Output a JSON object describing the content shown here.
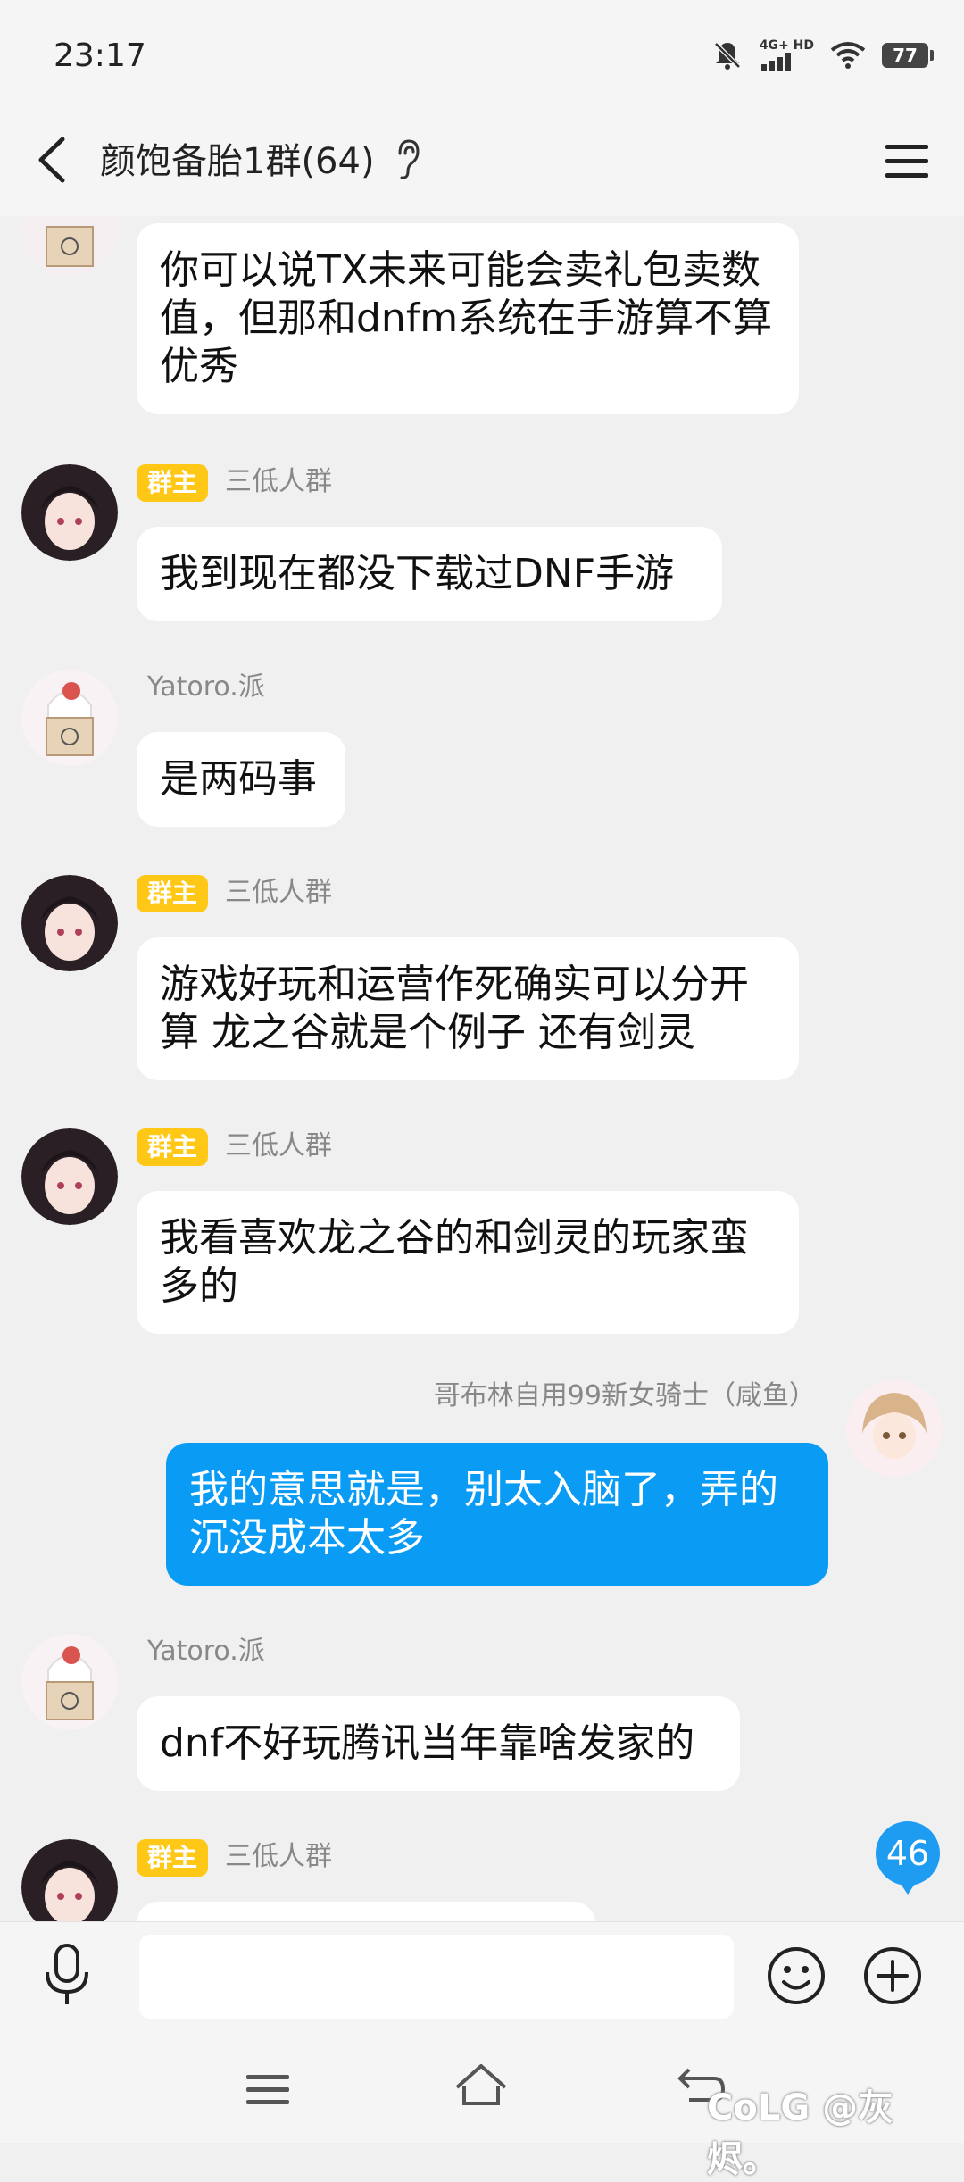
{
  "status_bar": {
    "time": "23:17",
    "network": "4G+ HD",
    "battery": "77"
  },
  "header": {
    "title": "颜饱备胎1群(64)"
  },
  "messages": [
    {
      "sender": "",
      "badge": "",
      "text": "你可以说TX未来可能会卖礼包卖数值，但那和dnfm系统在手游算不算优秀",
      "self": false
    },
    {
      "sender": "三低人群",
      "badge": "群主",
      "text": "我到现在都没下载过DNF手游",
      "self": false
    },
    {
      "sender": "Yatoro.派",
      "badge": "",
      "text": "是两码事",
      "self": false
    },
    {
      "sender": "三低人群",
      "badge": "群主",
      "text": "游戏好玩和运营作死确实可以分开算  龙之谷就是个例子 还有剑灵",
      "self": false
    },
    {
      "sender": "三低人群",
      "badge": "群主",
      "text": "我看喜欢龙之谷的和剑灵的玩家蛮多的",
      "self": false
    },
    {
      "sender": "哥布林自用99新女骑士（咸鱼）",
      "badge": "",
      "text": "我的意思就是，别太入脑了，弄的沉没成本太多",
      "self": true
    },
    {
      "sender": "Yatoro.派",
      "badge": "",
      "text": "dnf不好玩腾讯当年靠啥发家的",
      "self": false
    },
    {
      "sender": "三低人群",
      "badge": "群主",
      "text": "",
      "self": false
    }
  ],
  "unread_count": "46",
  "input": {
    "placeholder": ""
  },
  "watermark": "CoLG @灰烬。",
  "colors": {
    "self_bubble": "#0a9cf5",
    "owner_badge": "#ffc817",
    "background": "#f0f0f0"
  }
}
